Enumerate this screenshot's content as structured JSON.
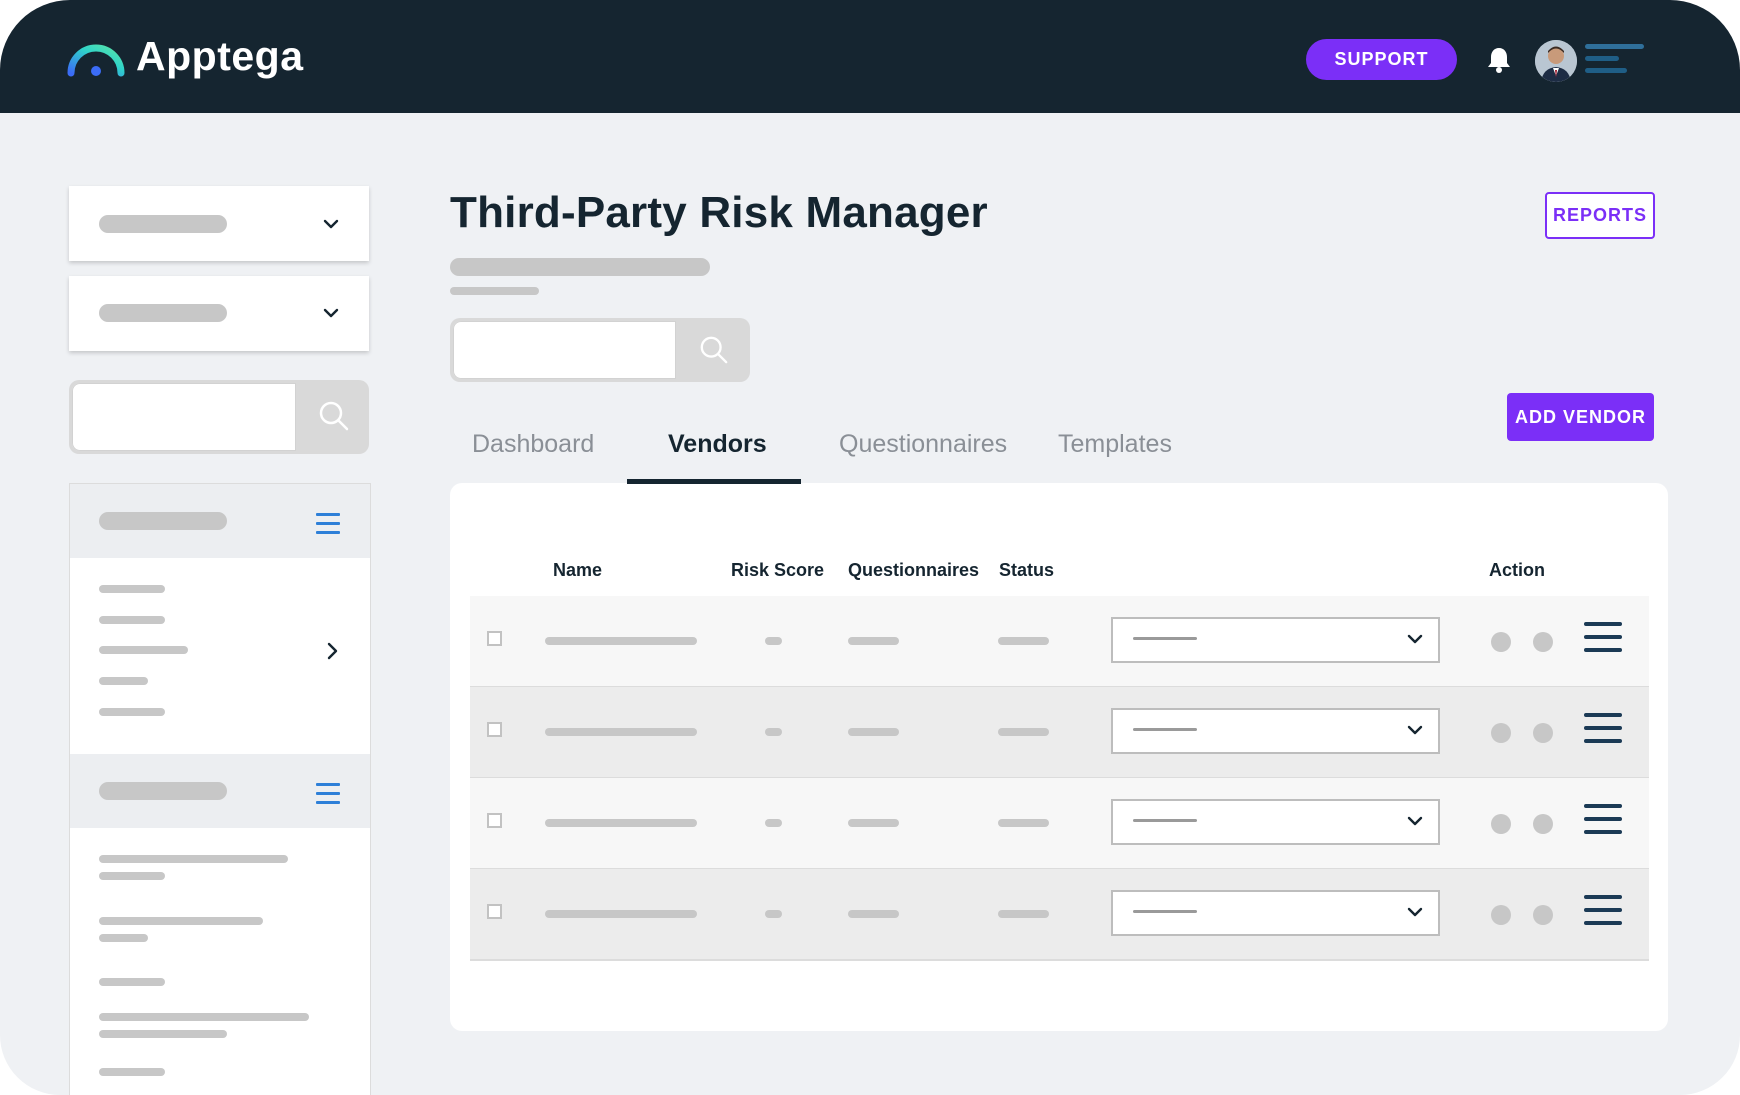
{
  "app": {
    "brand": "Apptega",
    "support_label": "SUPPORT"
  },
  "main": {
    "title": "Third-Party Risk Manager",
    "reports_label": "REPORTS",
    "add_vendor_label": "ADD VENDOR",
    "tabs": [
      {
        "label": "Dashboard",
        "active": false
      },
      {
        "label": "Vendors",
        "active": true
      },
      {
        "label": "Questionnaires",
        "active": false
      },
      {
        "label": "Templates",
        "active": false
      }
    ],
    "table": {
      "columns": [
        "Name",
        "Risk Score",
        "Questionnaires",
        "Status",
        "Action"
      ],
      "row_count": 4
    }
  },
  "colors": {
    "topbar": "#152530",
    "accent": "#7b2ff7",
    "icon_blue": "#2d7fd8",
    "placeholder": "#c7c7c7"
  },
  "icons": [
    "logo-arc-icon",
    "bell-icon",
    "menu-lines-icon",
    "chevron-down-icon",
    "chevron-right-icon",
    "search-icon",
    "hamburger-icon",
    "action-menu-icon"
  ]
}
